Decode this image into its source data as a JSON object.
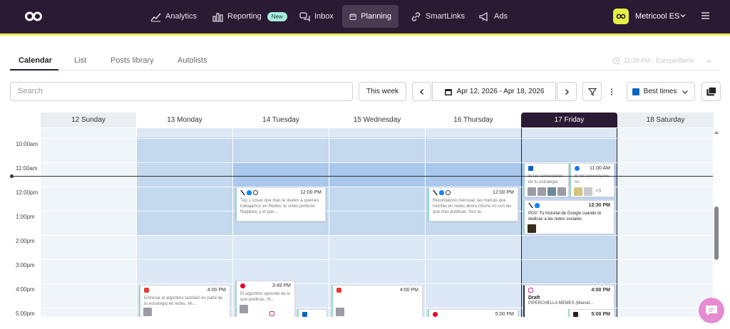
{
  "nav": {
    "items": [
      {
        "label": "Analytics",
        "icon": "analytics-icon"
      },
      {
        "label": "Reporting",
        "icon": "bar-chart-icon",
        "badge": "New"
      },
      {
        "label": "Inbox",
        "icon": "chat-bubbles-icon"
      },
      {
        "label": "Planning",
        "icon": "calendar-icon",
        "active": true
      },
      {
        "label": "SmartLinks",
        "icon": "link-icon"
      },
      {
        "label": "Ads",
        "icon": "megaphone-icon"
      }
    ],
    "brand_name": "Metricool ES"
  },
  "tabs": [
    "Calendar",
    "List",
    "Posts library",
    "Autolists"
  ],
  "timezone": "11:38 AM - Europe/Berlin",
  "toolbar": {
    "search_placeholder": "Search",
    "this_week": "This week",
    "date_range": "Apr 12, 2026 - Apr 18, 2026",
    "best_times": "Best times"
  },
  "days": [
    {
      "label": "12 Sunday",
      "today": false
    },
    {
      "label": "13 Monday",
      "today": false
    },
    {
      "label": "14 Tuesday",
      "today": false
    },
    {
      "label": "15 Wednesday",
      "today": false
    },
    {
      "label": "16 Thursday",
      "today": false
    },
    {
      "label": "17 Friday",
      "today": true
    },
    {
      "label": "18 Saturday",
      "today": false
    }
  ],
  "times": [
    "10:00am",
    "11:00am",
    "12:00pm",
    "1:00pm",
    "2:00pm",
    "3:00pm",
    "4:00pm",
    "5:00pm"
  ],
  "posts": [
    {
      "day": "14 Tuesday",
      "time": "12:00 PM",
      "networks": [
        "x",
        "bluesky",
        "threads"
      ],
      "text": "Top 1 cosas que más le duelen a quienes trabajamos en Redes: tu video perfecto flopppea, y el que..."
    },
    {
      "day": "16 Thursday",
      "time": "12:00 PM",
      "networks": [
        "x",
        "bluesky",
        "threads"
      ],
      "text": "Recordatorio mensual: las marcas que triunfan en redes ahora mismo no son las que más publican. Son la..."
    },
    {
      "day": "17 Friday",
      "time": "",
      "networks": [
        "linkedin"
      ],
      "text": "Si los comentarios de tu estrategia"
    },
    {
      "day": "17 Friday",
      "time": "11:00 AM",
      "networks": [
        "facebook"
      ],
      "text": "Si los comentarios no",
      "extra": "+3"
    },
    {
      "day": "17 Friday",
      "time": "12:30 PM",
      "networks": [
        "x",
        "bluesky"
      ],
      "text": "POV: Tu historial de Google cuando te dedicas a las redes sociales"
    },
    {
      "day": "13 Monday",
      "time": "4:00 PM",
      "networks": [
        "youtube"
      ],
      "text": "Entrenar el algoritmo también es parte de tu estrategia en redes. Mi..."
    },
    {
      "day": "14 Tuesday",
      "time": "3:49 PM",
      "networks": [
        "pinterest"
      ],
      "text": "El algoritmo aprende de lo que publicas. Si..."
    },
    {
      "day": "15 Wednesday",
      "time": "4:00 PM",
      "networks": [
        "youtube"
      ],
      "text": ""
    },
    {
      "day": "17 Friday",
      "time": "4:00 PM",
      "networks": [
        "instagram"
      ],
      "status": "Draft",
      "text": "PIPERCHELLA MEMES (Marvel..."
    },
    {
      "day": "16 Thursday",
      "time": "5:00 PM",
      "networks": [
        "pinterest"
      ],
      "text": ""
    },
    {
      "day": "15 Wednesday",
      "time": "5:00 PM",
      "networks": [
        "linkedin"
      ],
      "text": ""
    },
    {
      "day": "17 Friday",
      "time": "5:00 PM",
      "networks": [
        "tiktok"
      ],
      "text": ""
    }
  ],
  "colors": {
    "topbar": "#2b1a33",
    "accent_yellow": "#e8ef4a",
    "brand_avatar": "#e4f043",
    "today_header": "#2b1a33",
    "best_time_light": "#e6eff9",
    "best_time_mid": "#c7dcf2",
    "best_time_dark": "#a9c8ec",
    "chat_button": "#e58cd0"
  }
}
